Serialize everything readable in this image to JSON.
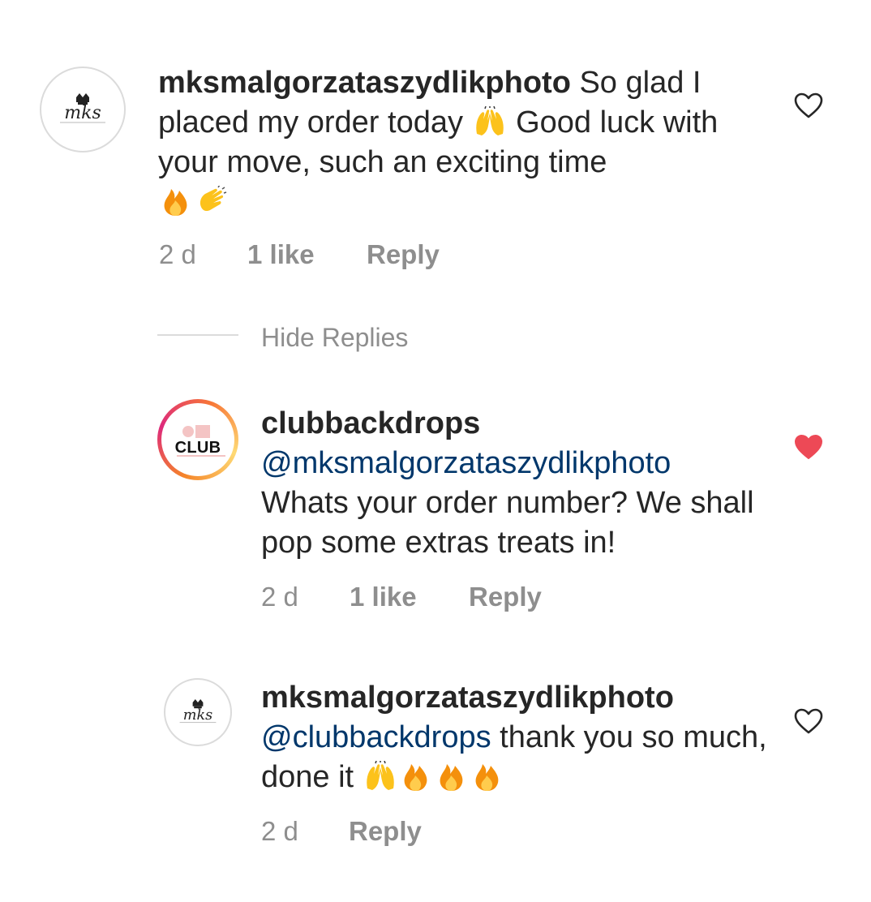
{
  "comments": [
    {
      "username": "mksmalgorzataszydlikphoto",
      "avatar_icon": "mks-logo-avatar",
      "text_parts": [
        " So glad I placed my order today ",
        " Good luck with your move, such an exciting time "
      ],
      "emojis": [
        "raising-hands",
        "fire",
        "clapping-hands"
      ],
      "time": "2 d",
      "likes": "1 like",
      "reply_label": "Reply",
      "liked": false
    },
    {
      "username": "clubbackdrops",
      "avatar_icon": "club-logo-avatar",
      "mention": "@mksmalgorzataszydlikphoto",
      "text": "Whats your order number? We shall pop some extras treats in!",
      "time": "2 d",
      "likes": "1 like",
      "reply_label": "Reply",
      "liked": true
    },
    {
      "username": "mksmalgorzataszydlikphoto",
      "avatar_icon": "mks-logo-avatar",
      "mention": "@clubbackdrops",
      "text": " thank you so much, done it ",
      "emojis": [
        "raising-hands",
        "fire",
        "fire",
        "fire"
      ],
      "time": "2 d",
      "reply_label": "Reply",
      "liked": false
    }
  ],
  "hide_replies_label": "Hide Replies",
  "club_avatar_text": "CLUB",
  "colors": {
    "text": "#262626",
    "meta": "#8e8e8e",
    "mention": "#00376b",
    "liked_heart": "#ed4956",
    "divider": "#dbdbdb"
  }
}
